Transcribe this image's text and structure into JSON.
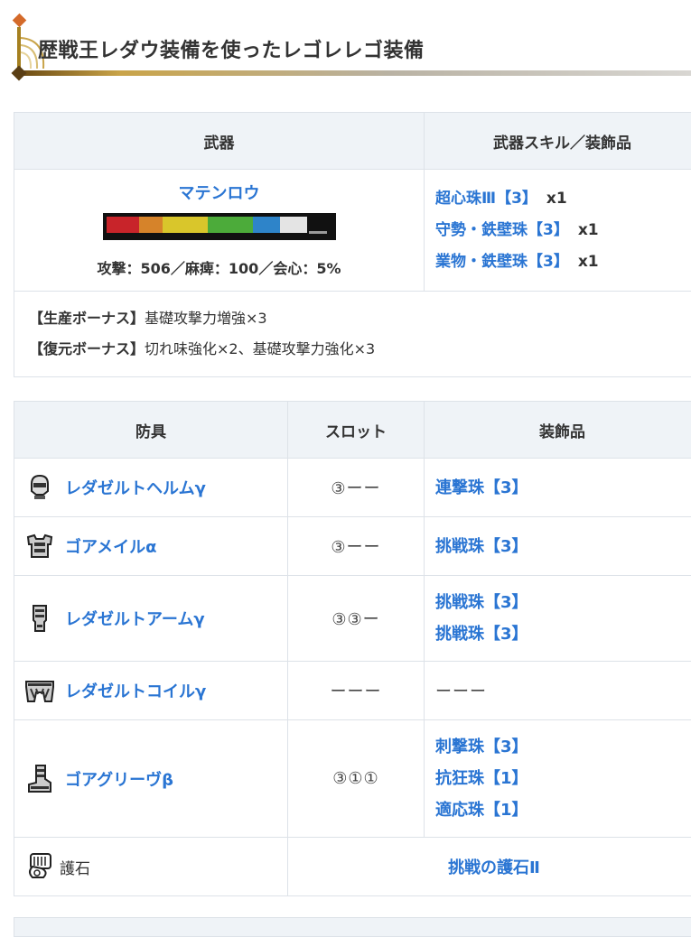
{
  "heading": {
    "title": "歴戦王レダウ装備を使ったレゴレレゴ装備"
  },
  "weapon_table": {
    "headers": {
      "weapon": "武器",
      "skills": "武器スキル／装飾品"
    },
    "weapon": {
      "name": "マテンロウ",
      "stats": "攻撃：506／麻痺：100／会心：5%",
      "sharpness_colors": [
        "#c8242a",
        "#d6832a",
        "#d9c62b",
        "#4cab3a",
        "#2e84c9",
        "#e4e4e4",
        "#7a7a7a"
      ]
    },
    "skills": [
      {
        "name": "超心珠Ⅲ【3】",
        "qty": "x1"
      },
      {
        "name": "守勢・鉄壁珠【3】",
        "qty": "x1"
      },
      {
        "name": "業物・鉄壁珠【3】",
        "qty": "x1"
      }
    ],
    "bonuses": [
      {
        "label": "【生産ボーナス】",
        "text": "基礎攻撃力増強×3"
      },
      {
        "label": "【復元ボーナス】",
        "text": "切れ味強化×2、基礎攻撃力強化×3"
      }
    ]
  },
  "armor_table": {
    "headers": {
      "armor": "防具",
      "slot": "スロット",
      "deco": "装飾品"
    },
    "rows": [
      {
        "icon": "helm-icon",
        "name": "レダゼルトヘルムγ",
        "slots": "③ーー",
        "decos": [
          "連撃珠【3】"
        ]
      },
      {
        "icon": "chest-icon",
        "name": "ゴアメイルα",
        "slots": "③ーー",
        "decos": [
          "挑戦珠【3】"
        ]
      },
      {
        "icon": "arm-icon",
        "name": "レダゼルトアームγ",
        "slots": "③③ー",
        "decos": [
          "挑戦珠【3】",
          "挑戦珠【3】"
        ]
      },
      {
        "icon": "waist-icon",
        "name": "レダゼルトコイルγ",
        "slots": "ーーー",
        "decos": [],
        "deco_placeholder": "ーーー"
      },
      {
        "icon": "leg-icon",
        "name": "ゴアグリーヴβ",
        "slots": "③①①",
        "decos": [
          "刺撃珠【3】",
          "抗狂珠【1】",
          "適応珠【1】"
        ]
      }
    ],
    "charm": {
      "icon": "charm-icon",
      "label": "護石",
      "name": "挑戦の護石Ⅱ"
    }
  }
}
